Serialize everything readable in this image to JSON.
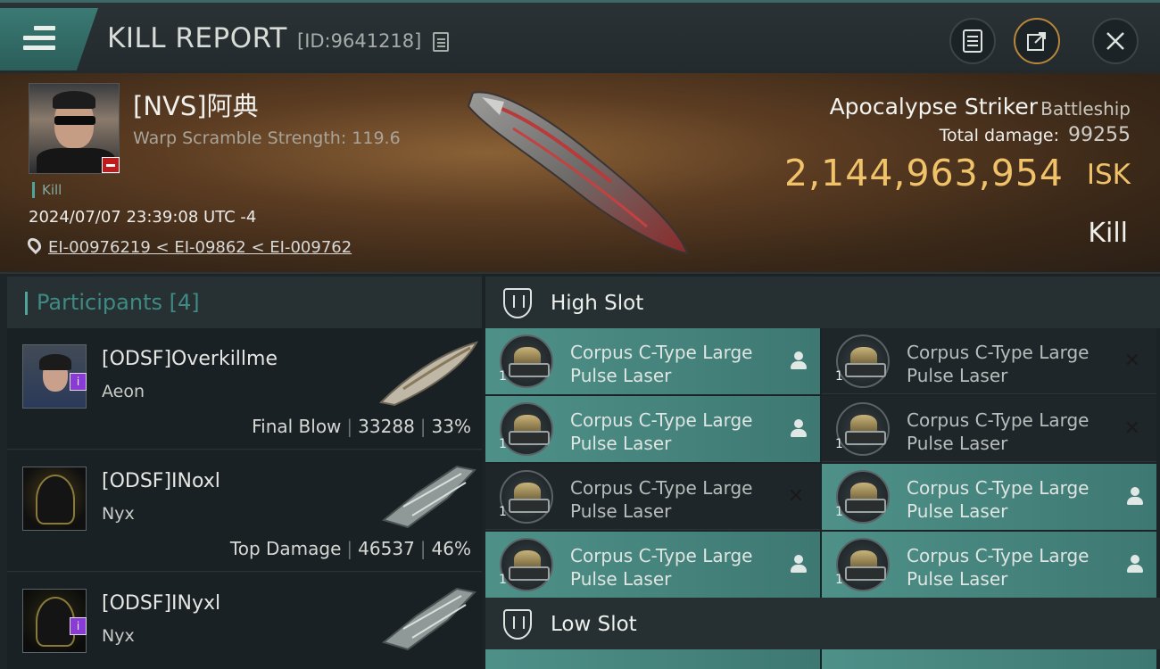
{
  "header": {
    "title": "KILL REPORT",
    "report_id": "[ID:9641218]"
  },
  "victim": {
    "name": "[NVS]阿典",
    "warp_scramble": "Warp Scramble Strength: 119.6",
    "kill_tag": "Kill",
    "datetime": "2024/07/07 23:39:08 UTC -4",
    "location": "EI-00976219 < EI-09862 < EI-009762",
    "ship_name": "Apocalypse Striker",
    "ship_class": "Battleship",
    "total_damage_label": "Total damage:",
    "total_damage": "99255",
    "isk_value": "2,144,963,954",
    "isk_unit": "ISK",
    "result": "Kill"
  },
  "participants": {
    "label": "Participants",
    "count": "[4]",
    "rows": [
      {
        "name": "[ODSF]Overkillme",
        "ship": "Aeon",
        "role": "Final Blow",
        "damage": "33288",
        "percent": "33%",
        "badge": "i"
      },
      {
        "name": "[ODSF]INoxl",
        "ship": "Nyx",
        "role": "Top Damage",
        "damage": "46537",
        "percent": "46%"
      },
      {
        "name": "[ODSF]INyxl",
        "ship": "Nyx",
        "badge": "i"
      }
    ]
  },
  "slots": {
    "high_label": "High Slot",
    "low_label": "Low Slot",
    "high_modules": [
      {
        "name": "Corpus C-Type Large Pulse Laser",
        "qty": "1",
        "state": "on"
      },
      {
        "name": "Corpus C-Type Large Pulse Laser",
        "qty": "1",
        "state": "off"
      },
      {
        "name": "Corpus C-Type Large Pulse Laser",
        "qty": "1",
        "state": "on"
      },
      {
        "name": "Corpus C-Type Large Pulse Laser",
        "qty": "1",
        "state": "off"
      },
      {
        "name": "Corpus C-Type Large Pulse Laser",
        "qty": "1",
        "state": "off"
      },
      {
        "name": "Corpus C-Type Large Pulse Laser",
        "qty": "1",
        "state": "on"
      },
      {
        "name": "Corpus C-Type Large Pulse Laser",
        "qty": "1",
        "state": "on"
      },
      {
        "name": "Corpus C-Type Large Pulse Laser",
        "qty": "1",
        "state": "on"
      }
    ]
  },
  "icons": {
    "menu": "hamburger-icon",
    "copy": "copy-icon",
    "notes": "clipboard-icon",
    "share": "share-icon",
    "close": "close-icon",
    "location": "location-pin-icon",
    "slot": "slot-icon",
    "dropped": "person-icon",
    "destroyed": "x-icon"
  },
  "colors": {
    "accent": "#4fa59a",
    "isk": "#f0c26a",
    "module_active": "#4e9189"
  }
}
